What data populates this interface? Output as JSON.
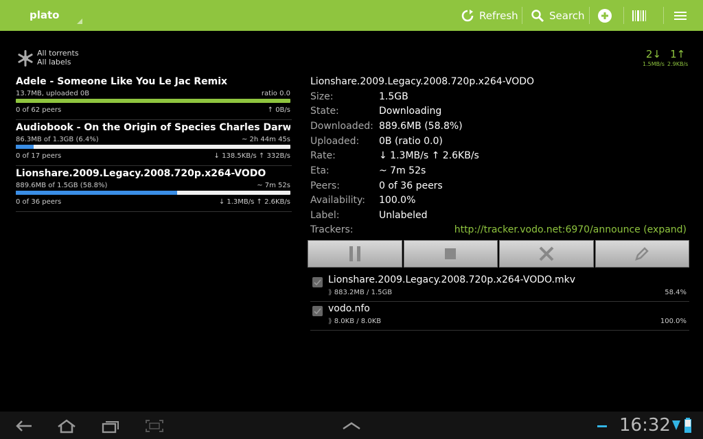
{
  "app": {
    "title": "plato",
    "actions": {
      "refresh": "Refresh",
      "search": "Search"
    }
  },
  "filter": {
    "line1": "All torrents",
    "line2": "All labels"
  },
  "speeds": {
    "down_count": "2↓",
    "down_rate": "1.5MB/s",
    "up_count": "1↑",
    "up_rate": "2.9KB/s"
  },
  "torrents": [
    {
      "name": "Adele - Someone Like You Le Jac Remix",
      "info": "13.7MB, uploaded 0B",
      "right": "ratio 0.0",
      "progress": 1.0,
      "color": "#8fc53f",
      "peers": "0 of 62 peers",
      "rate": "↑ 0B/s"
    },
    {
      "name": "Audiobook - On the Origin of Species  Charles Darwin_",
      "info": "86.3MB of 1.3GB (6.4%)",
      "right": "~ 2h 44m 45s",
      "progress": 0.064,
      "color": "#3a8ee6",
      "peers": "0 of 17 peers",
      "rate": "↓ 138.5KB/s ↑ 332B/s"
    },
    {
      "name": "Lionshare.2009.Legacy.2008.720p.x264-VODO",
      "info": "889.6MB of 1.5GB (58.8%)",
      "right": "~ 7m 52s",
      "progress": 0.588,
      "color": "#3a8ee6",
      "peers": "0 of 36 peers",
      "rate": "↓ 1.3MB/s ↑ 2.6KB/s"
    }
  ],
  "details": {
    "title": "Lionshare.2009.Legacy.2008.720p.x264-VODO",
    "rows": [
      {
        "k": "Size:",
        "v": "1.5GB"
      },
      {
        "k": "State:",
        "v": "Downloading"
      },
      {
        "k": "Downloaded:",
        "v": "889.6MB (58.8%)"
      },
      {
        "k": "Uploaded:",
        "v": "0B (ratio 0.0)"
      },
      {
        "k": "Rate:",
        "v": "↓ 1.3MB/s ↑ 2.6KB/s"
      },
      {
        "k": "Eta:",
        "v": "~ 7m 52s"
      },
      {
        "k": "Peers:",
        "v": "0 of 36 peers"
      },
      {
        "k": "Availability:",
        "v": "100.0%"
      },
      {
        "k": "Label:",
        "v": "Unlabeled"
      },
      {
        "k": "Trackers:",
        "v": ""
      }
    ],
    "tracker": "http://tracker.vodo.net:6970/announce (expand)"
  },
  "files": [
    {
      "name": "Lionshare.2009.Legacy.2008.720p.x264-VODO.mkv",
      "size": "883.2MB / 1.5GB",
      "pct": "58.4%"
    },
    {
      "name": "vodo.nfo",
      "size": "8.0KB / 8.0KB",
      "pct": "100.0%"
    }
  ],
  "system": {
    "clock": "16:32"
  },
  "colors": {
    "accent": "#8fc53f",
    "progress_blue": "#3a8ee6"
  }
}
